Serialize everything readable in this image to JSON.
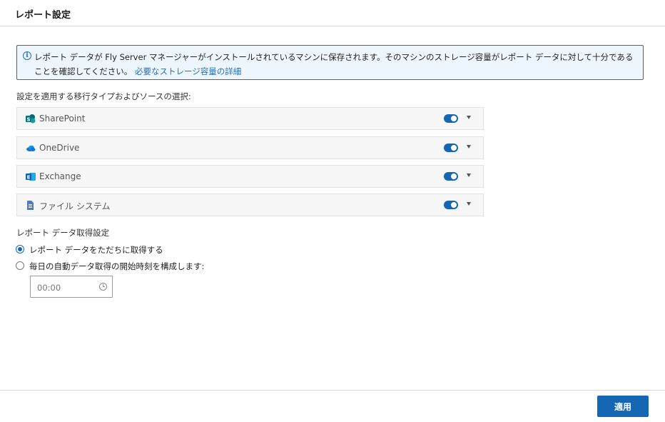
{
  "header": {
    "title": "レポート設定"
  },
  "info": {
    "text": "レポート データが Fly Server マネージャーがインストールされているマシンに保存されます。そのマシンのストレージ容量がレポート データに対して十分であることを確認してください。",
    "link": "必要なストレージ容量の詳細",
    "icon": "info-icon"
  },
  "sources": {
    "label": "設定を適用する移行タイプおよびソースの選択:",
    "items": [
      {
        "label": "SharePoint",
        "icon": "sharepoint-icon",
        "enabled": true
      },
      {
        "label": "OneDrive",
        "icon": "onedrive-icon",
        "enabled": true
      },
      {
        "label": "Exchange",
        "icon": "exchange-icon",
        "enabled": true
      },
      {
        "label": "ファイル システム",
        "icon": "file-system-icon",
        "enabled": true
      }
    ]
  },
  "report": {
    "label": "レポート データ取得設定",
    "options": [
      {
        "label": "レポート データをただちに取得する",
        "checked": true
      },
      {
        "label": "毎日の自動データ取得の開始時刻を構成します:",
        "checked": false
      }
    ],
    "time_value": "00:00"
  },
  "footer": {
    "apply_label": "適用"
  },
  "colors": {
    "accent": "#1567b3",
    "info_bg": "#eef6fd",
    "border": "#1f6fba"
  }
}
